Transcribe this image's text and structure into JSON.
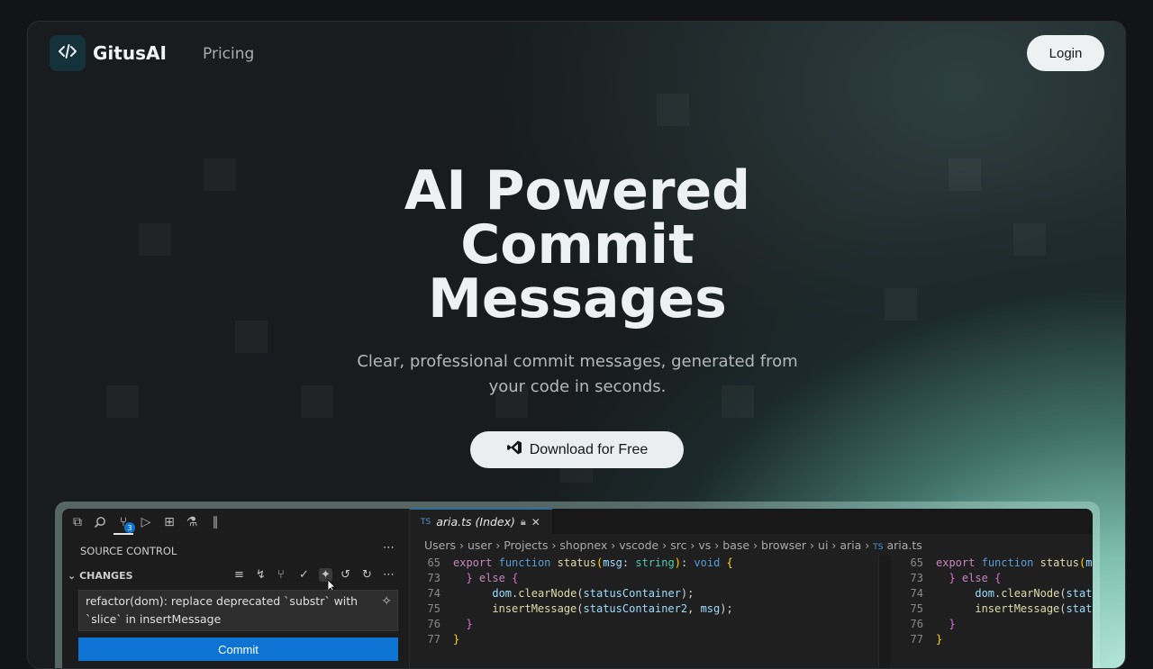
{
  "nav": {
    "brand": "GitusAI",
    "links": [
      "Pricing"
    ],
    "login": "Login"
  },
  "hero": {
    "title_lines": [
      "AI Powered",
      "Commit",
      "Messages"
    ],
    "subtitle_lines": [
      "Clear, professional commit messages, generated from",
      "your code in seconds."
    ],
    "download": "Download for Free"
  },
  "editor": {
    "source_control": "SOURCE CONTROL",
    "changes": "CHANGES",
    "scm_badge": "3",
    "commit_message": "refactor(dom): replace deprecated `substr` with `slice` in insertMessage",
    "commit_button": "Commit",
    "tab": {
      "lang": "TS",
      "name": "aria.ts (Index)"
    },
    "breadcrumb": [
      "Users",
      "user",
      "Projects",
      "shopnex",
      "vscode",
      "src",
      "vs",
      "base",
      "browser",
      "ui",
      "aria"
    ],
    "breadcrumb_file": "aria.ts",
    "line_numbers": [
      "65",
      "73",
      "74",
      "75",
      "76",
      "77"
    ]
  },
  "colors": {
    "accent": "#0e74d4",
    "background": "#181c1e",
    "glow": "#b4e6d8"
  }
}
